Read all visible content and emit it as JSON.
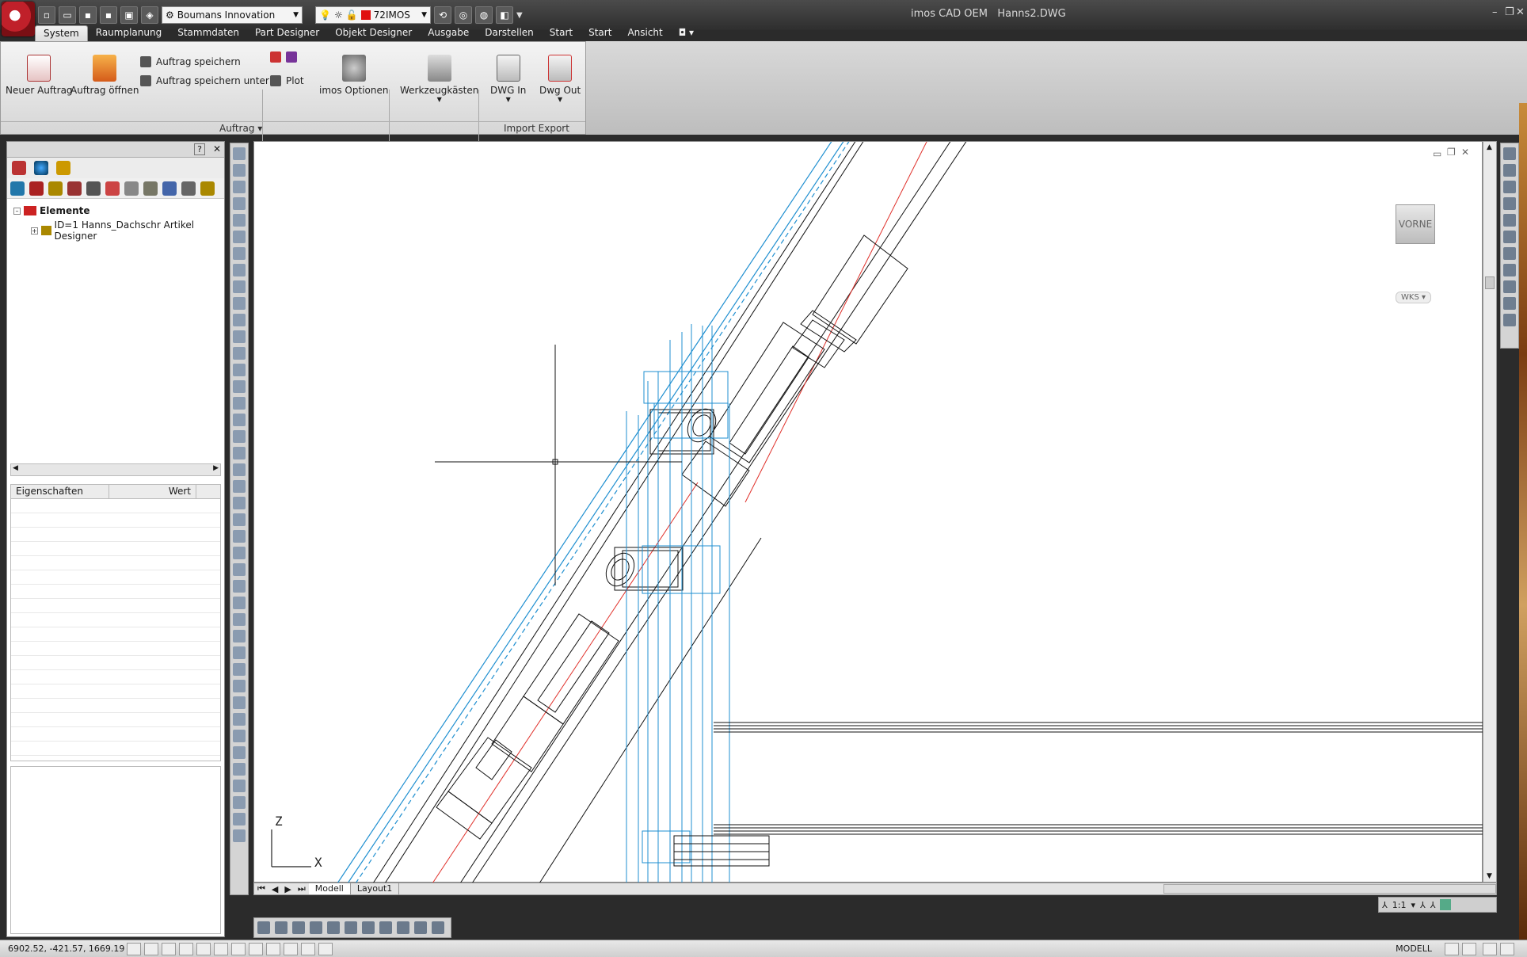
{
  "window": {
    "app": "imos CAD OEM",
    "file": "Hanns2.DWG"
  },
  "qat": {
    "workspace": "Boumans Innovation",
    "layer": "72IMOS"
  },
  "tabs": [
    "System",
    "Raumplanung",
    "Stammdaten",
    "Part Designer",
    "Objekt Designer",
    "Ausgabe",
    "Darstellen",
    "Start",
    "Start",
    "Ansicht"
  ],
  "ribbon": {
    "new_order": "Neuer Auftrag",
    "open_order": "Auftrag öffnen",
    "save_order": "Auftrag speichern",
    "save_order_as": "Auftrag speichern unter",
    "plot": "Plot",
    "options": "imos Optionen",
    "toolboxes": "Werkzeugkästen",
    "dwg_in": "DWG In",
    "dwg_out": "Dwg Out",
    "panel_auftrag": "Auftrag",
    "panel_import_export": "Import Export"
  },
  "palette": {
    "help": "?",
    "close": "✕",
    "tree_root": "Elemente",
    "tree_child": "ID=1 Hanns_Dachschr Artikel Designer",
    "props_col1": "Eigenschaften",
    "props_col2": "Wert"
  },
  "viewport": {
    "viewcube": "VORNE",
    "wcs": "WKS",
    "axis_z": "Z",
    "axis_x": "X"
  },
  "layout_tabs": [
    "Modell",
    "Layout1"
  ],
  "annotation": {
    "scale": "1:1"
  },
  "status": {
    "coords": "6902.52, -421.57, 1669.19",
    "space": "MODELL"
  },
  "colors": {
    "blue": "#1f8fd0",
    "red": "#e0302a",
    "ink": "#111111"
  }
}
